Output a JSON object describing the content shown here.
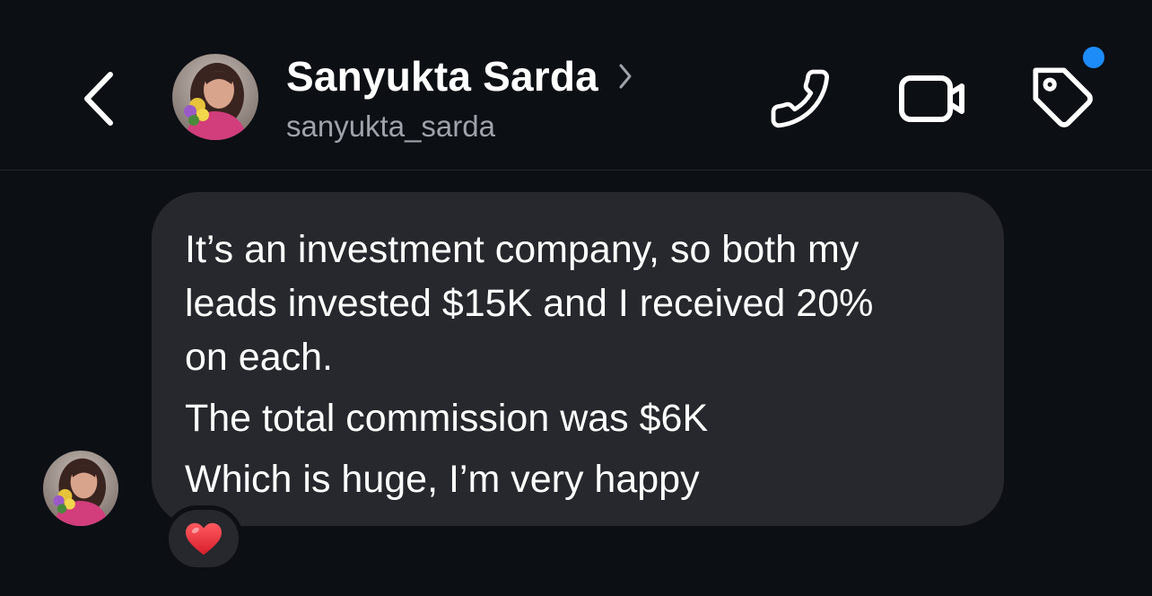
{
  "header": {
    "name": "Sanyukta Sarda",
    "username": "sanyukta_sarda",
    "icons": {
      "back": "chevron-left-icon",
      "name_chevron": "chevron-right-icon",
      "call": "phone-icon",
      "video": "video-camera-icon",
      "label": "tag-icon"
    },
    "notification_dot_color": "#1d8cf8"
  },
  "message": {
    "lines": [
      "It’s an investment company, so both my",
      "leads invested $15K and I received 20%",
      "on each.",
      "The total commission was $6K",
      "Which is huge, I’m very happy"
    ],
    "bubble_color": "#26282d",
    "reaction": "❤️"
  },
  "colors": {
    "background": "#0c0f14",
    "secondary_text": "#9ea3ab"
  }
}
